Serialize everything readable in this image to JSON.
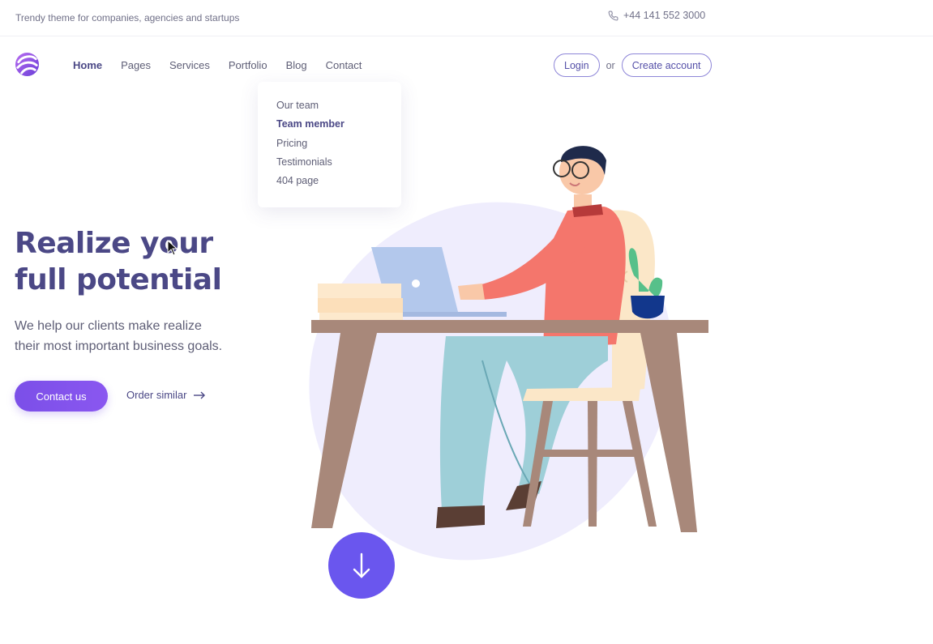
{
  "topbar": {
    "tagline": "Trendy theme for companies, agencies and startups",
    "phone": "+44 141 552 3000"
  },
  "nav": {
    "items": [
      {
        "label": "Home",
        "active": true
      },
      {
        "label": "Pages",
        "active": false
      },
      {
        "label": "Services",
        "active": false
      },
      {
        "label": "Portfolio",
        "active": false
      },
      {
        "label": "Blog",
        "active": false
      },
      {
        "label": "Contact",
        "active": false
      }
    ],
    "login_label": "Login",
    "or_label": "or",
    "create_account_label": "Create account"
  },
  "dropdown": {
    "items": [
      {
        "label": "Our team"
      },
      {
        "label": "Team member"
      },
      {
        "label": "Pricing"
      },
      {
        "label": "Testimonials"
      },
      {
        "label": "404 page"
      }
    ]
  },
  "hero": {
    "title_line1": "Realize your",
    "title_line2": "full potential",
    "subtitle_line1": "We help our clients make realize",
    "subtitle_line2": "their most important business goals.",
    "contact_label": "Contact us",
    "order_label": "Order similar"
  },
  "colors": {
    "accent": "#6a56ee",
    "heading": "#4b4886",
    "blob": "#efedfd"
  },
  "icons": {
    "phone": "phone-icon",
    "arrow": "arrow-right-icon",
    "scroll": "arrow-down-icon",
    "logo": "brand-logo"
  }
}
